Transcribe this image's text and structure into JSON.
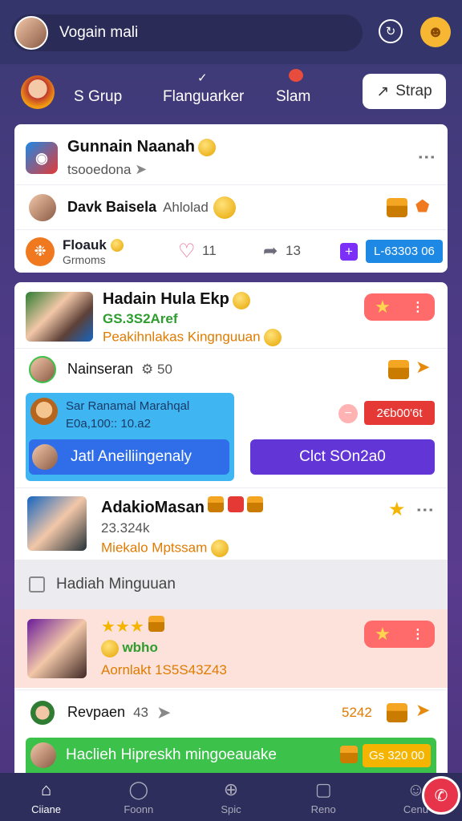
{
  "header": {
    "search_text": "Vogain mali",
    "history_icon": "clock-refresh-icon",
    "emoji_icon": "smiley-icon"
  },
  "groupbar": {
    "tab1": "S Grup",
    "tab2": "Flanguarker",
    "tab3": "Slam",
    "strap_label": "Strap"
  },
  "card1": {
    "title": "Gunnain Naanah",
    "subtitle": "tsooedona",
    "row2_title": "Davk Baisela",
    "row2_extra": "Ahlolad",
    "row3_title": "Floauk",
    "row3_sub": "Grmoms",
    "like_count": "11",
    "share_count": "13",
    "badge_value": "L-63303 06"
  },
  "card2": {
    "post1_title": "Hadain Hula Ekp",
    "post1_green": "GS.3S2Aref",
    "post1_orange": "Peakihnlakas Kingnguuan",
    "row2_title": "Nainseran",
    "row2_count": "50",
    "feature_title": "Sar Ranamal Marahqal",
    "feature_sub": "E0a,100:: 10.a2",
    "feature_btn": "Jatl Aneiliingenaly",
    "red_pill": "2€b00'6t",
    "purple_btn": "Clct SOn2a0",
    "post2_title": "AdakioMasan",
    "post2_stat": "23.324k",
    "post2_orange": "Miekalo Mptssam",
    "section_title": "Hadiah Minguuan",
    "post3_line2": "wbho",
    "post3_orange": "Aornlakt 1S5S43Z43",
    "row4_title": "Revpaen",
    "row4_count": "43",
    "row4_value": "5242",
    "banner_text": "Haclieh Hipreskh mingoeauake",
    "banner_pill": "Gs 320 00"
  },
  "nav": [
    {
      "label": "Ciiane",
      "icon": "home-icon"
    },
    {
      "label": "Foonn",
      "icon": "compass-icon"
    },
    {
      "label": "Spic",
      "icon": "add-circle-icon"
    },
    {
      "label": "Reno",
      "icon": "gift-icon"
    },
    {
      "label": "Cenu",
      "icon": "profile-icon"
    }
  ],
  "colors": {
    "accent_purple": "#6236d6",
    "accent_blue": "#2f6ee8",
    "accent_red": "#e53935",
    "accent_green": "#3cc24a"
  }
}
